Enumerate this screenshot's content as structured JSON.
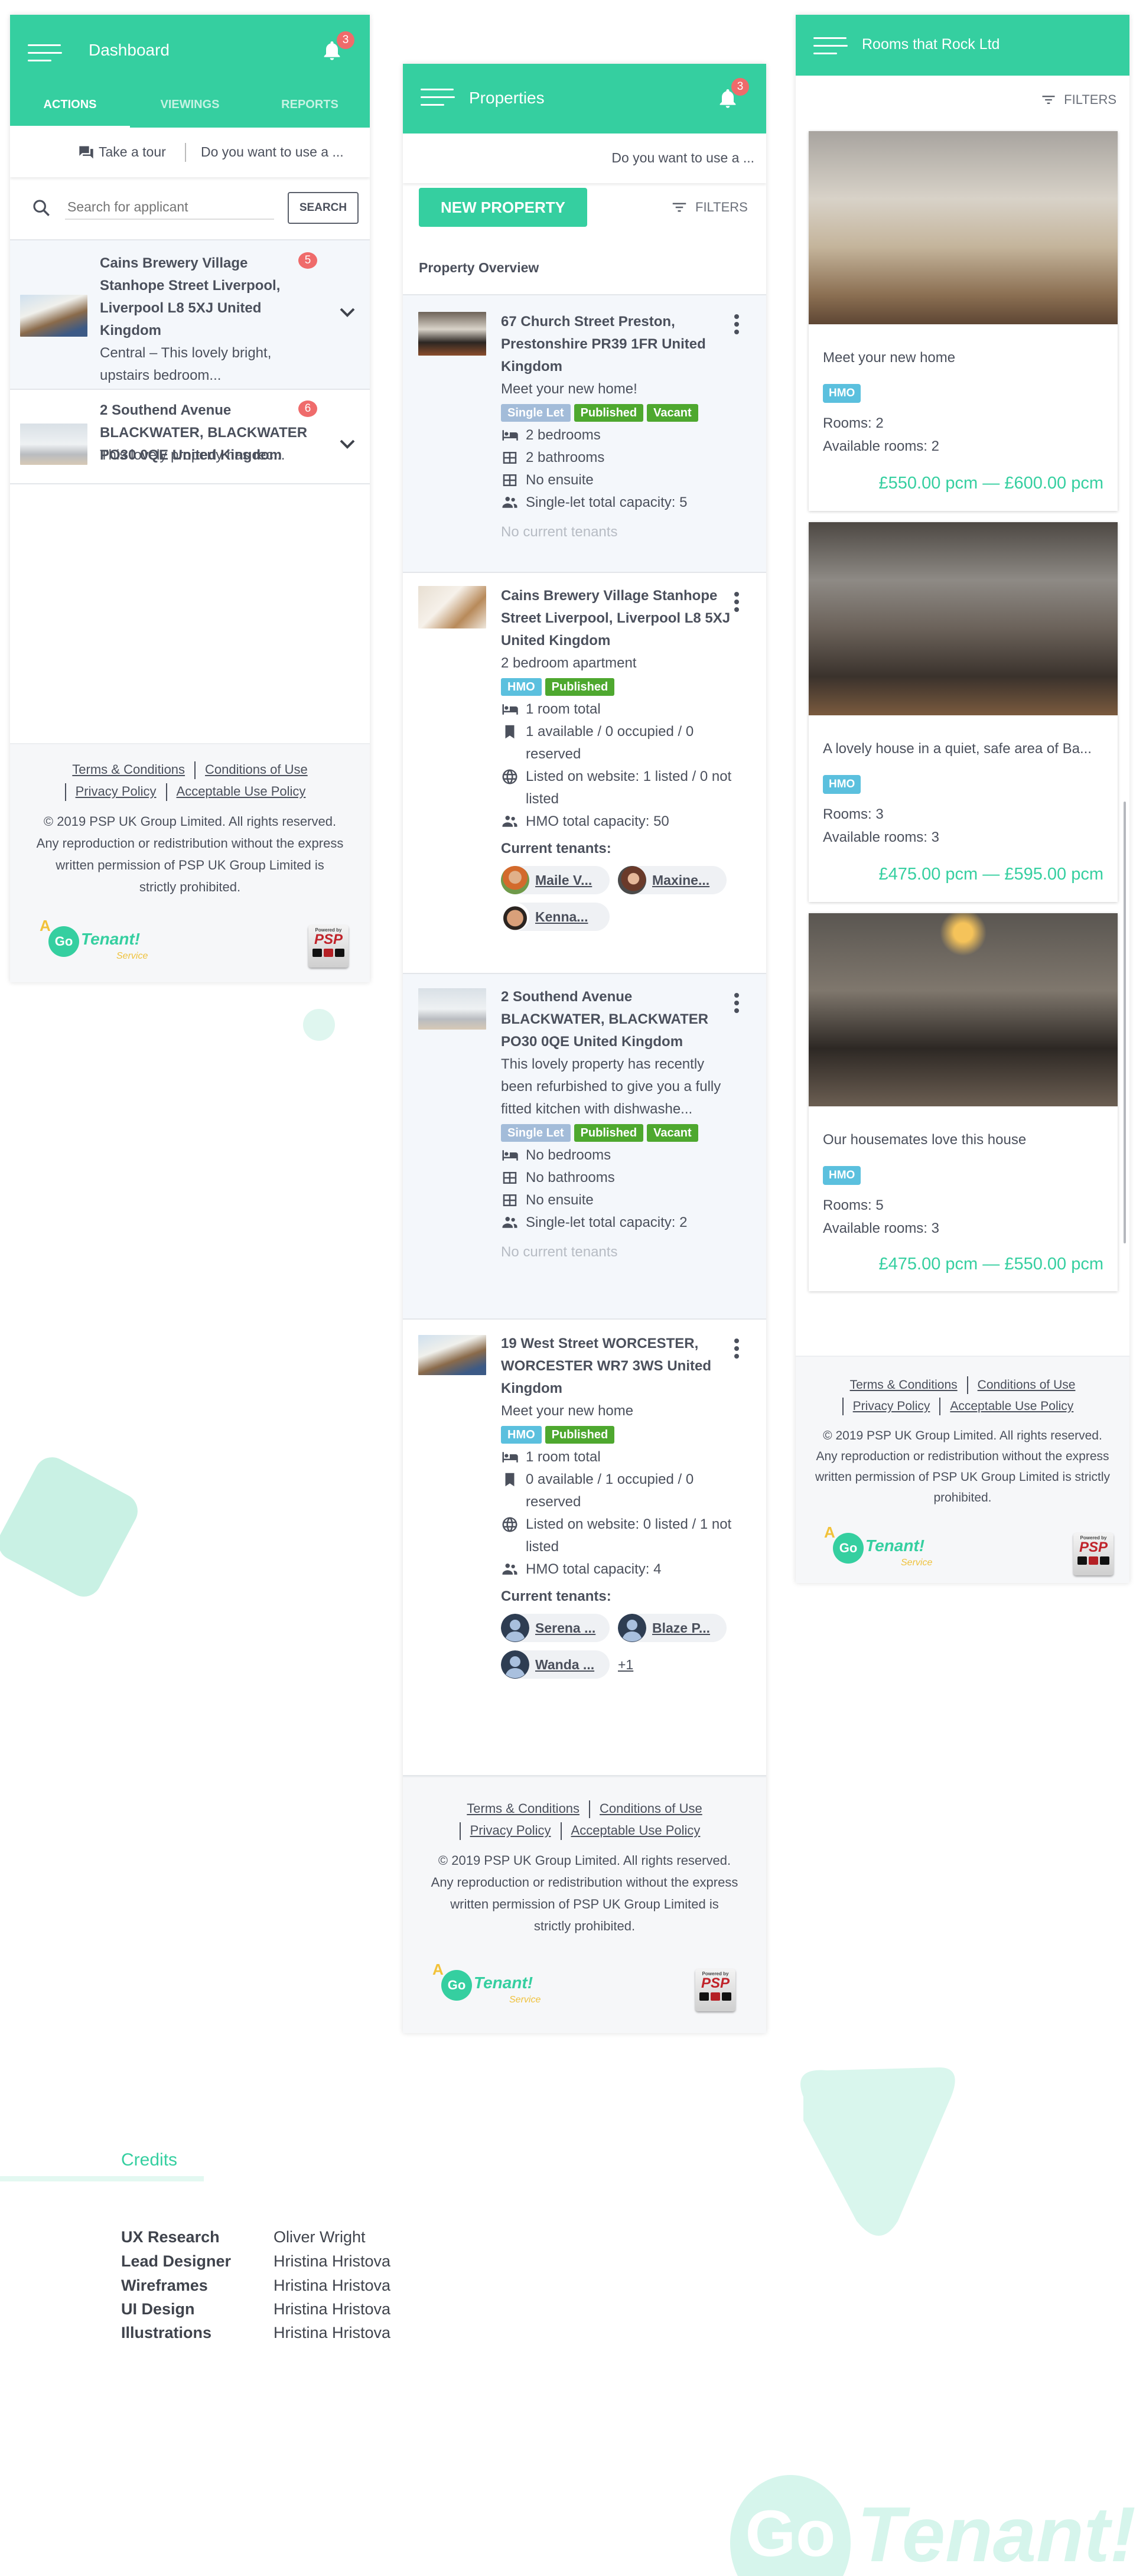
{
  "colors": {
    "accent": "#35cfa0",
    "badge": "#ef6b6b",
    "published": "#4ea82f",
    "single_let": "#a3bcd9",
    "hmo": "#5bc0de"
  },
  "dashboard": {
    "title": "Dashboard",
    "notifications": "3",
    "tabs": [
      {
        "label": "ACTIONS",
        "active": true
      },
      {
        "label": "VIEWINGS"
      },
      {
        "label": "REPORTS"
      }
    ],
    "tour": "Take a tour",
    "prompt": "Do you want to use a ...",
    "search": {
      "placeholder": "Search for applicant",
      "button": "SEARCH"
    },
    "items": [
      {
        "title": "Cains Brewery Village Stanhope Street Liverpool, Liverpool L8 5XJ United Kingdom",
        "desc": "Central – This lovely bright, upstairs bedroom...",
        "badge": "5"
      },
      {
        "title": "2 Southend Avenue BLACKWATER, BLACKWATER PO30 0QE United Kingdom",
        "desc": "This lovely property has rec...",
        "badge": "6"
      }
    ]
  },
  "properties": {
    "title": "Properties",
    "notifications": "3",
    "prompt": "Do you want to use a ...",
    "new_button": "NEW PROPERTY",
    "filters": "FILTERS",
    "overview": "Property Overview",
    "cards": [
      {
        "title": "67 Church Street Preston, Prestonshire PR39 1FR United Kingdom",
        "desc": "Meet your new home!",
        "tags": [
          "Single Let",
          "Published",
          "Vacant"
        ],
        "features": [
          "2 bedrooms",
          "2 bathrooms",
          "No ensuite",
          "Single-let total capacity: 5"
        ],
        "no_tenants": "No current tenants"
      },
      {
        "title": "Cains Brewery Village Stanhope Street Liverpool, Liverpool L8 5XJ United Kingdom",
        "desc": "2 bedroom apartment",
        "tags": [
          "HMO",
          "Published"
        ],
        "features": [
          "1 room total",
          "1 available / 0 occupied / 0 reserved",
          "Listed on website: 1 listed / 0 not listed",
          "HMO total capacity: 50"
        ],
        "tenants_label": "Current tenants:",
        "tenants": [
          "Maile V...",
          "Maxine...",
          "Kenna..."
        ]
      },
      {
        "title": "2 Southend Avenue BLACKWATER, BLACKWATER PO30 0QE United Kingdom",
        "desc": "This lovely property has recently been refurbished to give you a fully fitted kitchen with dishwashe...",
        "tags": [
          "Single Let",
          "Published",
          "Vacant"
        ],
        "features": [
          "No bedrooms",
          "No bathrooms",
          "No ensuite",
          "Single-let total capacity: 2"
        ],
        "no_tenants": "No current tenants"
      },
      {
        "title": "19 West Street WORCESTER, WORCESTER WR7 3WS United Kingdom",
        "desc": "Meet your new home",
        "tags": [
          "HMO",
          "Published"
        ],
        "features": [
          "1 room total",
          "0 available / 1 occupied / 0 reserved",
          "Listed on website: 0 listed / 1 not listed",
          "HMO total capacity: 4"
        ],
        "tenants_label": "Current tenants:",
        "tenants": [
          "Serena ...",
          "Blaze P...",
          "Wanda ..."
        ],
        "more": "+1"
      }
    ]
  },
  "rooms": {
    "title": "Rooms that Rock Ltd",
    "filters": "FILTERS",
    "cards": [
      {
        "desc": "Meet your new home",
        "tag": "HMO",
        "rooms": "Rooms: 2",
        "available": "Available rooms: 2",
        "price": "£550.00 pcm — £600.00 pcm"
      },
      {
        "desc": "A lovely house in a quiet, safe area of Ba...",
        "tag": "HMO",
        "rooms": "Rooms: 3",
        "available": "Available rooms: 3",
        "price": "£475.00 pcm — £595.00 pcm"
      },
      {
        "desc": "Our housemates love this house",
        "tag": "HMO",
        "rooms": "Rooms: 5",
        "available": "Available rooms: 3",
        "price": "£475.00 pcm — £550.00 pcm"
      }
    ]
  },
  "footer": {
    "links": [
      "Terms & Conditions",
      "Conditions of Use",
      "Privacy Policy",
      "Acceptable Use Policy"
    ],
    "copyright": "© 2019 PSP UK Group Limited. All rights reserved. Any reproduction or redistribution without the express written permission of PSP UK Group Limited is strictly prohibited."
  },
  "logos": {
    "gotenant": {
      "a": "A",
      "go": "Go",
      "name": "Tenant!",
      "service": "Service"
    },
    "psp": {
      "powered": "Powered by",
      "name": "PSP"
    }
  },
  "credits": {
    "title": "Credits",
    "rows": [
      {
        "role": "UX Research",
        "name": "Oliver Wright"
      },
      {
        "role": "Lead Designer",
        "name": "Hristina Hristova"
      },
      {
        "role": "Wireframes",
        "name": "Hristina Hristova"
      },
      {
        "role": "UI Design",
        "name": "Hristina Hristova"
      },
      {
        "role": "Illustrations",
        "name": "Hristina Hristova"
      }
    ]
  }
}
